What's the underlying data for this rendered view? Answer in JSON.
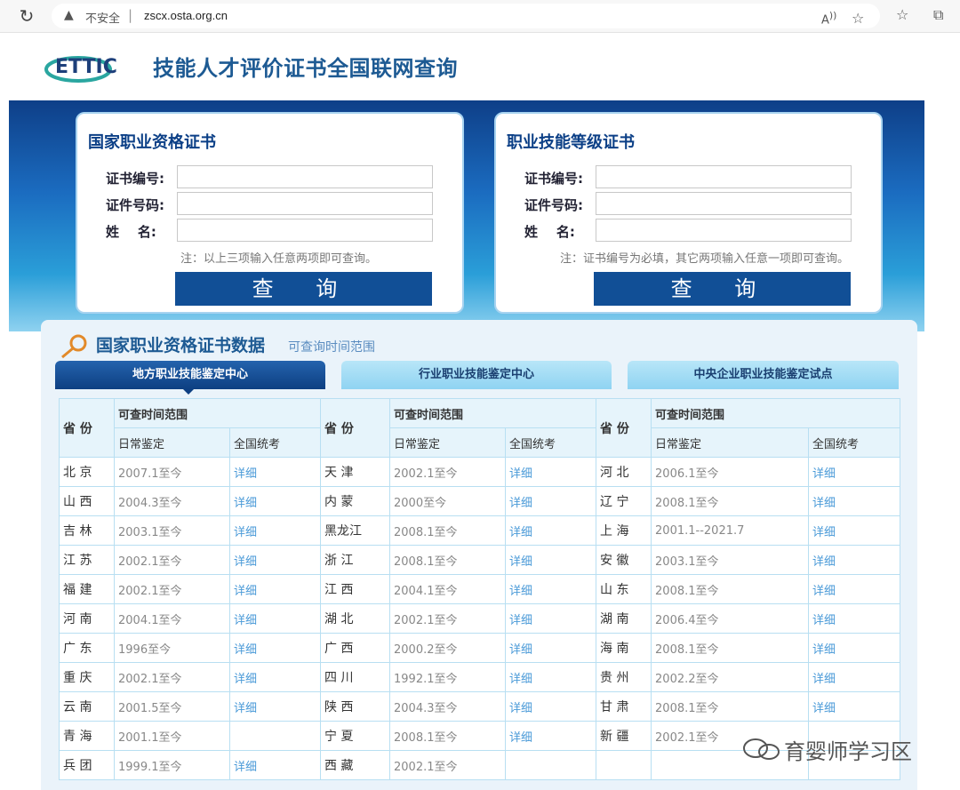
{
  "browser": {
    "security_text": "不安全",
    "separator": "|",
    "url": "zscx.osta.org.cn"
  },
  "header": {
    "logo_text": "ETTIC",
    "title": "技能人才评价证书全国联网查询"
  },
  "panels": [
    {
      "title": "国家职业资格证书",
      "fields": [
        {
          "label": "证书编号:",
          "value": ""
        },
        {
          "label": "证件号码:",
          "value": ""
        },
        {
          "label": "姓    名:",
          "value": ""
        }
      ],
      "note": "注：以上三项输入任意两项即可查询。",
      "button": "查 询"
    },
    {
      "title": "职业技能等级证书",
      "fields": [
        {
          "label": "证书编号:",
          "value": ""
        },
        {
          "label": "证件号码:",
          "value": ""
        },
        {
          "label": "姓    名:",
          "value": ""
        }
      ],
      "note": "注：证书编号为必填，其它两项输入任意一项即可查询。",
      "button": "查 询"
    }
  ],
  "section": {
    "title": "国家职业资格证书数据",
    "subtitle": "可查询时间范围",
    "tabs": [
      "地方职业技能鉴定中心",
      "行业职业技能鉴定中心",
      "中央企业职业技能鉴定试点"
    ],
    "active_tab": 0
  },
  "table": {
    "province_header": "省 份",
    "range_header": "可查时间范围",
    "daily_header": "日常鉴定",
    "national_header": "全国统考",
    "rows": [
      [
        [
          "北 京",
          "2007.1至今",
          "详细"
        ],
        [
          "天 津",
          "2002.1至今",
          "详细"
        ],
        [
          "河 北",
          "2006.1至今",
          "详细"
        ]
      ],
      [
        [
          "山 西",
          "2004.3至今",
          "详细"
        ],
        [
          "内 蒙",
          "2000至今",
          "详细"
        ],
        [
          "辽 宁",
          "2008.1至今",
          "详细"
        ]
      ],
      [
        [
          "吉 林",
          "2003.1至今",
          "详细"
        ],
        [
          "黑龙江",
          "2008.1至今",
          "详细"
        ],
        [
          "上 海",
          "2001.1--2021.7",
          "详细"
        ]
      ],
      [
        [
          "江 苏",
          "2002.1至今",
          "详细"
        ],
        [
          "浙 江",
          "2008.1至今",
          "详细"
        ],
        [
          "安 徽",
          "2003.1至今",
          "详细"
        ]
      ],
      [
        [
          "福 建",
          "2002.1至今",
          "详细"
        ],
        [
          "江 西",
          "2004.1至今",
          "详细"
        ],
        [
          "山 东",
          "2008.1至今",
          "详细"
        ]
      ],
      [
        [
          "河 南",
          "2004.1至今",
          "详细"
        ],
        [
          "湖 北",
          "2002.1至今",
          "详细"
        ],
        [
          "湖 南",
          "2006.4至今",
          "详细"
        ]
      ],
      [
        [
          "广 东",
          "1996至今",
          "详细"
        ],
        [
          "广 西",
          "2000.2至今",
          "详细"
        ],
        [
          "海 南",
          "2008.1至今",
          "详细"
        ]
      ],
      [
        [
          "重 庆",
          "2002.1至今",
          "详细"
        ],
        [
          "四 川",
          "1992.1至今",
          "详细"
        ],
        [
          "贵 州",
          "2002.2至今",
          "详细"
        ]
      ],
      [
        [
          "云 南",
          "2001.5至今",
          "详细"
        ],
        [
          "陕 西",
          "2004.3至今",
          "详细"
        ],
        [
          "甘 肃",
          "2008.1至今",
          "详细"
        ]
      ],
      [
        [
          "青 海",
          "2001.1至今",
          ""
        ],
        [
          "宁 夏",
          "2008.1至今",
          "详细"
        ],
        [
          "新 疆",
          "2002.1至今",
          ""
        ]
      ],
      [
        [
          "兵 团",
          "1999.1至今",
          "详细"
        ],
        [
          "西 藏",
          "2002.1至今",
          ""
        ],
        [
          "",
          "",
          ""
        ]
      ]
    ]
  },
  "watermark": "育婴师学习区",
  "colors": {
    "brand_blue": "#114f96",
    "link_blue": "#4a9ad8",
    "title_blue": "#1d5a93"
  }
}
